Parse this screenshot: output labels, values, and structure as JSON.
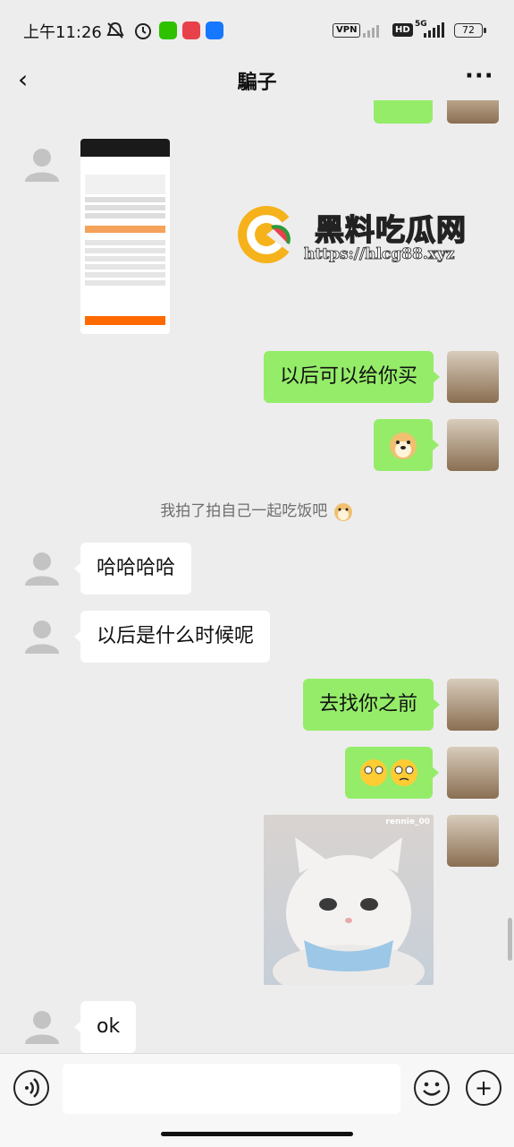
{
  "status_bar": {
    "time": "上午11:26",
    "vpn": "VPN",
    "hd": "HD",
    "network": "5G",
    "battery": "72"
  },
  "nav": {
    "back_icon": "‹",
    "title": "騙子",
    "more_icon": "···"
  },
  "messages": {
    "m1": "以后可以给你买",
    "m2_emoji": "doge-emoji",
    "system_notice": "我拍了拍自己一起吃饭吧",
    "m3": "哈哈哈哈",
    "m4": "以后是什么时候呢",
    "m5": "去找你之前",
    "m6_emoji": "pleading-emoji",
    "m7_image_caption": "rennie_00",
    "m8": "ok"
  },
  "watermark": {
    "title": "黑料吃瓜网",
    "url": "https://hlcg88.xyz"
  },
  "bottom_bar": {
    "voice_icon": "voice-icon",
    "emoji_icon": "emoji-icon",
    "plus_icon": "+"
  },
  "colors": {
    "background": "#ededed",
    "green_bubble": "#95ec69",
    "white_bubble": "#ffffff"
  }
}
